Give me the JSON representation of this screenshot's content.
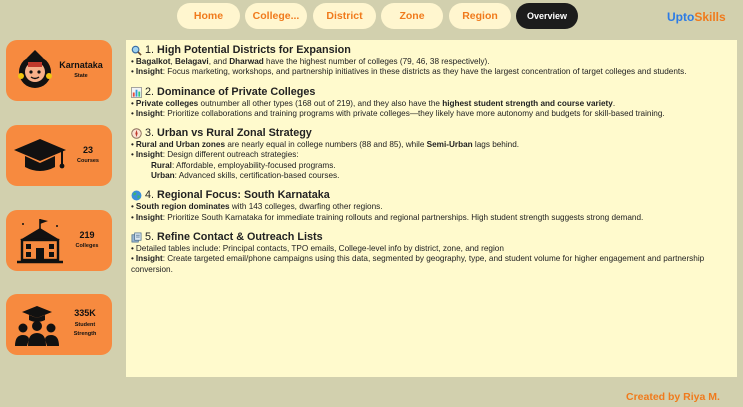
{
  "nav": {
    "tabs": [
      {
        "label": "Home"
      },
      {
        "label": "College..."
      },
      {
        "label": "District"
      },
      {
        "label": "Zone"
      },
      {
        "label": "Region"
      },
      {
        "label": "Overview"
      }
    ],
    "active_tab": "Overview",
    "brand_part1": "Upto",
    "brand_part2": "Skills"
  },
  "cards": {
    "state": {
      "value": "Karnataka",
      "label": "State",
      "icon": "karnataka-emblem-icon"
    },
    "courses": {
      "value": "23",
      "label": "Courses",
      "icon": "graduation-cap-icon"
    },
    "colleges": {
      "value": "219",
      "label": "Colleges",
      "icon": "college-building-icon"
    },
    "students": {
      "value": "335K",
      "label1": "Student",
      "label2": "Strength",
      "icon": "students-icon"
    }
  },
  "insights": {
    "s1": {
      "num": "1.",
      "title": "High Potential Districts for Expansion",
      "icon": "magnifier-icon",
      "l1_b1": "Bagalkot",
      "l1_t1": ", ",
      "l1_b2": "Belagavi",
      "l1_t2": ", and ",
      "l1_b3": "Dharwad",
      "l1_t3": " have the highest number of colleges (79, 46, 38 respectively).",
      "l2_b": "Insight",
      "l2_t": ": Focus marketing, workshops, and partnership initiatives in these districts as they have the largest concentration of target colleges and students."
    },
    "s2": {
      "num": "2.",
      "title": "Dominance of Private Colleges",
      "icon": "bar-chart-icon",
      "l1_b1": "Private colleges",
      "l1_t1": " outnumber all other types (168 out of 219), and they also have the ",
      "l1_b2": "highest student strength and course variety",
      "l1_t2": ".",
      "l2_b": "Insight",
      "l2_t": ": Prioritize collaborations and training programs with private colleges—they likely have more autonomy and budgets for skill-based training."
    },
    "s3": {
      "num": "3.",
      "title": "Urban vs Rural Zonal Strategy",
      "icon": "compass-icon",
      "l1_b1": "Rural and Urban zones",
      "l1_t1": " are nearly equal in college numbers (88 and 85), while ",
      "l1_b2": "Semi-Urban",
      "l1_t2": " lags behind.",
      "l2_b": "Insight",
      "l2_t": ": Design different outreach strategies:",
      "sub1_b": "Rural",
      "sub1_t": ": Affordable, employability-focused programs.",
      "sub2_b": "Urban",
      "sub2_t": ": Advanced skills, certification-based courses."
    },
    "s4": {
      "num": "4.",
      "title": "Regional Focus: South Karnataka",
      "icon": "globe-icon",
      "l1_b1": "South region dominates",
      "l1_t1": " with 143 colleges, dwarfing other regions.",
      "l2_b": "Insight",
      "l2_t": ": Prioritize South Karnataka for immediate training rollouts and regional partnerships. High student strength suggests strong demand."
    },
    "s5": {
      "num": "5.",
      "title": "Refine Contact & Outreach Lists",
      "icon": "contact-list-icon",
      "l1_t1": "Detailed tables include: Principal contacts, TPO emails, College-level info by district, zone, and region",
      "l2_b": "Insight",
      "l2_t": ": Create targeted email/phone campaigns using this data, segmented by geography, type, and student volume for higher engagement and partnership conversion."
    }
  },
  "footer": {
    "text": "Created by Riya M."
  },
  "colors": {
    "background": "#d2d0ae",
    "card": "#f78a3f",
    "panel": "#fffacd",
    "accent": "#f07a1c",
    "brand_blue": "#2c7be5"
  }
}
